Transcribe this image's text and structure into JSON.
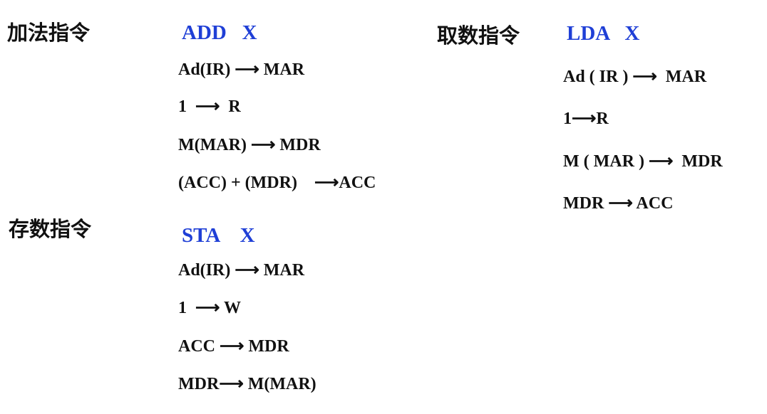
{
  "add": {
    "label": "加法指令",
    "instruction": "ADD   X",
    "steps": [
      "Ad(IR) ⟶ MAR",
      "1  ⟶  R",
      "M(MAR) ⟶ MDR",
      "(ACC) + (MDR)    ⟶ACC"
    ]
  },
  "sta": {
    "label": "存数指令",
    "instruction": "STA    X",
    "steps": [
      "Ad(IR) ⟶ MAR",
      "1  ⟶ W",
      "ACC ⟶ MDR",
      "MDR⟶ M(MAR)"
    ]
  },
  "lda": {
    "label": "取数指令",
    "instruction": "LDA   X",
    "steps": [
      "Ad ( IR ) ⟶  MAR",
      "1⟶R",
      "M ( MAR ) ⟶  MDR",
      "MDR ⟶ ACC"
    ]
  },
  "colors": {
    "instruction": "#1f3fd6",
    "text": "#111111",
    "background": "#ffffff"
  }
}
